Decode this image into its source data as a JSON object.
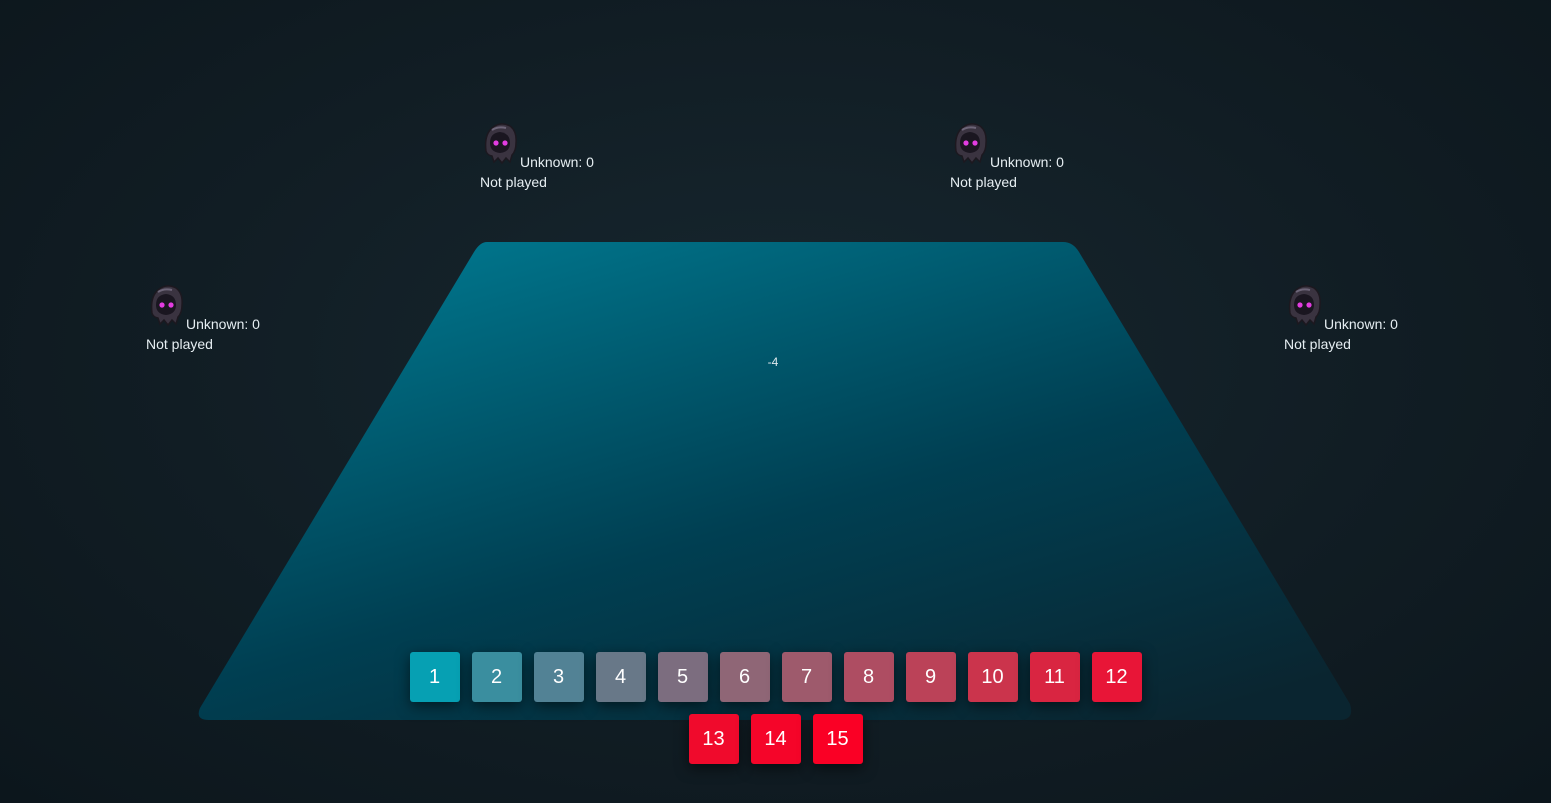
{
  "table": {
    "center_value": "-4",
    "colors": {
      "felt_light": "#00788f",
      "felt_dark": "#00303f"
    }
  },
  "players": [
    {
      "id": "player-top-left",
      "avatar_icon": "hooded-ghost-icon",
      "name_label": "Unknown: 0",
      "status": "Not played"
    },
    {
      "id": "player-top-right",
      "avatar_icon": "hooded-ghost-icon",
      "name_label": "Unknown: 0",
      "status": "Not played"
    },
    {
      "id": "player-left",
      "avatar_icon": "hooded-ghost-icon",
      "name_label": "Unknown: 0",
      "status": "Not played"
    },
    {
      "id": "player-right",
      "avatar_icon": "hooded-ghost-icon",
      "name_label": "Unknown: 0",
      "status": "Not played"
    }
  ],
  "hand": {
    "cards": [
      {
        "label": "1",
        "color": "#06a0b3"
      },
      {
        "label": "2",
        "color": "#3a8e9f"
      },
      {
        "label": "3",
        "color": "#528295"
      },
      {
        "label": "4",
        "color": "#687888"
      },
      {
        "label": "5",
        "color": "#7c6d7f"
      },
      {
        "label": "6",
        "color": "#8f6676"
      },
      {
        "label": "7",
        "color": "#9e5a6c"
      },
      {
        "label": "8",
        "color": "#ae4d62"
      },
      {
        "label": "9",
        "color": "#bb4258"
      },
      {
        "label": "10",
        "color": "#cb344c"
      },
      {
        "label": "11",
        "color": "#d92541"
      },
      {
        "label": "12",
        "color": "#e81537"
      },
      {
        "label": "13",
        "color": "#f00a2c"
      },
      {
        "label": "14",
        "color": "#f50529"
      },
      {
        "label": "15",
        "color": "#fa0025"
      }
    ]
  }
}
